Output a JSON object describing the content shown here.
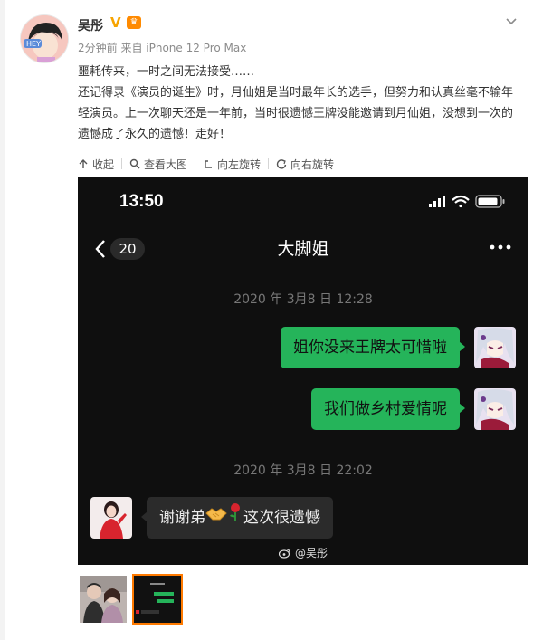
{
  "author": {
    "name": "吴彤",
    "meta": "2分钟前 来自 iPhone 12 Pro Max"
  },
  "post": {
    "line1": "噩耗传来，一时之间无法接受……",
    "line2": "还记得录《演员的诞生》时，月仙姐是当时最年长的选手，但努力和认真丝毫不输年轻演员。上一次聊天还是一年前，当时很遗憾王牌没能邀请到月仙姐，没想到一次的遗憾成了永久的遗憾！走好！"
  },
  "toolbar": {
    "collapse": "收起",
    "view_large": "查看大图",
    "rotate_left": "向左旋转",
    "rotate_right": "向右旋转"
  },
  "phone": {
    "time": "13:50",
    "unread": "20",
    "title": "大脚姐",
    "timestamp1": "2020 年 3月8 日 12:28",
    "timestamp2": "2020 年 3月8 日 22:02",
    "msg1": "姐你没来王牌太可惜啦",
    "msg2": "我们做乡村爱情呢",
    "reply_prefix": "谢谢弟",
    "reply_suffix": "这次很遗憾",
    "watermark": "@吴彤"
  },
  "colors": {
    "wechat_green": "#25b45a",
    "active_thumb": "#ff7a00"
  }
}
